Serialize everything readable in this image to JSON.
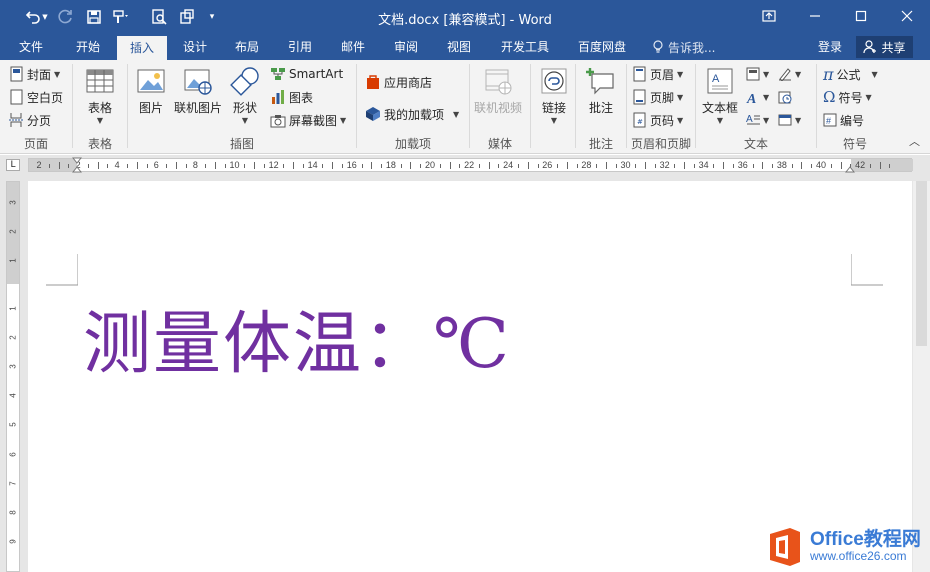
{
  "window": {
    "title": "文档.docx [兼容模式] - Word"
  },
  "tabs": [
    {
      "label": "文件"
    },
    {
      "label": "开始"
    },
    {
      "label": "插入"
    },
    {
      "label": "设计"
    },
    {
      "label": "布局"
    },
    {
      "label": "引用"
    },
    {
      "label": "邮件"
    },
    {
      "label": "审阅"
    },
    {
      "label": "视图"
    },
    {
      "label": "开发工具"
    },
    {
      "label": "百度网盘"
    }
  ],
  "active_tab": "插入",
  "tell_me": "告诉我...",
  "account": {
    "login": "登录",
    "share": "共享"
  },
  "ribbon": {
    "pages": {
      "label": "页面",
      "cover": "封面",
      "blank": "空白页",
      "break": "分页"
    },
    "tables": {
      "label": "表格",
      "table": "表格"
    },
    "illustrations": {
      "label": "插图",
      "picture": "图片",
      "online_picture": "联机图片",
      "shapes": "形状",
      "smartart": "SmartArt",
      "chart": "图表",
      "screenshot": "屏幕截图"
    },
    "addins": {
      "label": "加载项",
      "store": "应用商店",
      "my_addins": "我的加载项"
    },
    "media": {
      "label": "媒体",
      "online_video": "联机视频"
    },
    "links": {
      "link": "链接"
    },
    "comments": {
      "label": "批注",
      "comment": "批注"
    },
    "header_footer": {
      "label": "页眉和页脚",
      "header": "页眉",
      "footer": "页脚",
      "page_number": "页码"
    },
    "text": {
      "label": "文本",
      "textbox": "文本框"
    },
    "symbols": {
      "label": "符号",
      "equation": "公式",
      "symbol": "符号",
      "numbering": "编号"
    }
  },
  "ruler": {
    "h_labels": [
      "2",
      "2",
      "4",
      "6",
      "8",
      "10",
      "12",
      "14",
      "16",
      "18",
      "20",
      "22",
      "24",
      "26",
      "28",
      "30",
      "32",
      "34",
      "36",
      "38",
      "40",
      "42"
    ],
    "v_labels": [
      "3",
      "2",
      "1",
      "1",
      "2",
      "3",
      "4",
      "5",
      "6",
      "7",
      "8",
      "9"
    ]
  },
  "document": {
    "text": "测量体温：℃",
    "text_color": "#7030a0"
  },
  "watermark": {
    "line1": "Office教程网",
    "line2": "www.office26.com"
  },
  "colors": {
    "accent": "#2b579a",
    "ribbon_bg": "#f3f3f3"
  }
}
